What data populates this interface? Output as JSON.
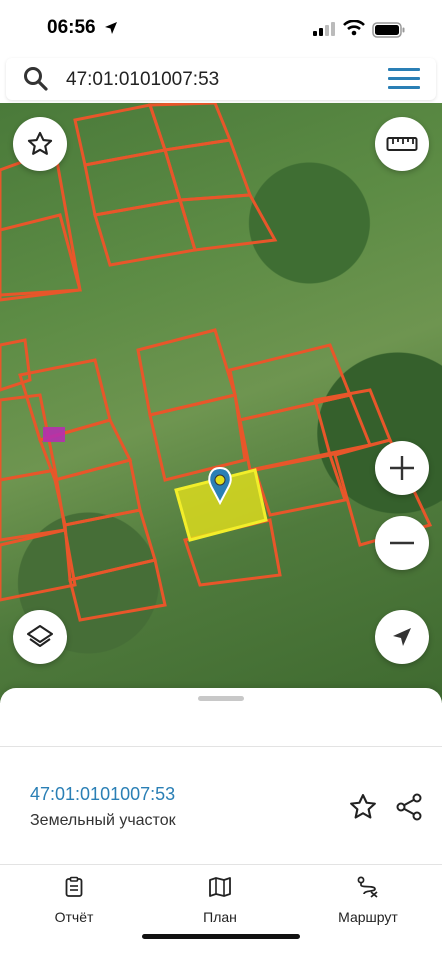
{
  "status_bar": {
    "time": "06:56"
  },
  "search": {
    "query": "47:01:0101007:53",
    "placeholder": ""
  },
  "map": {
    "selected_parcel_color": "#e2e01c",
    "parcel_border_color": "#e8562a",
    "highlight_parcel_color": "#b62fb0",
    "marker_color": "#2a7fb5"
  },
  "map_controls": {
    "favorite": "star-icon",
    "ruler": "ruler-icon",
    "zoom_in": "plus-icon",
    "zoom_out": "minus-icon",
    "layers": "layers-icon",
    "locate": "navigation-arrow-icon"
  },
  "sheet": {
    "cadastral_number": "47:01:0101007:53",
    "object_type": "Земельный участок"
  },
  "tabs": [
    {
      "label": "Отчёт",
      "icon": "report-icon"
    },
    {
      "label": "План",
      "icon": "map-plan-icon"
    },
    {
      "label": "Маршрут",
      "icon": "route-icon"
    }
  ]
}
